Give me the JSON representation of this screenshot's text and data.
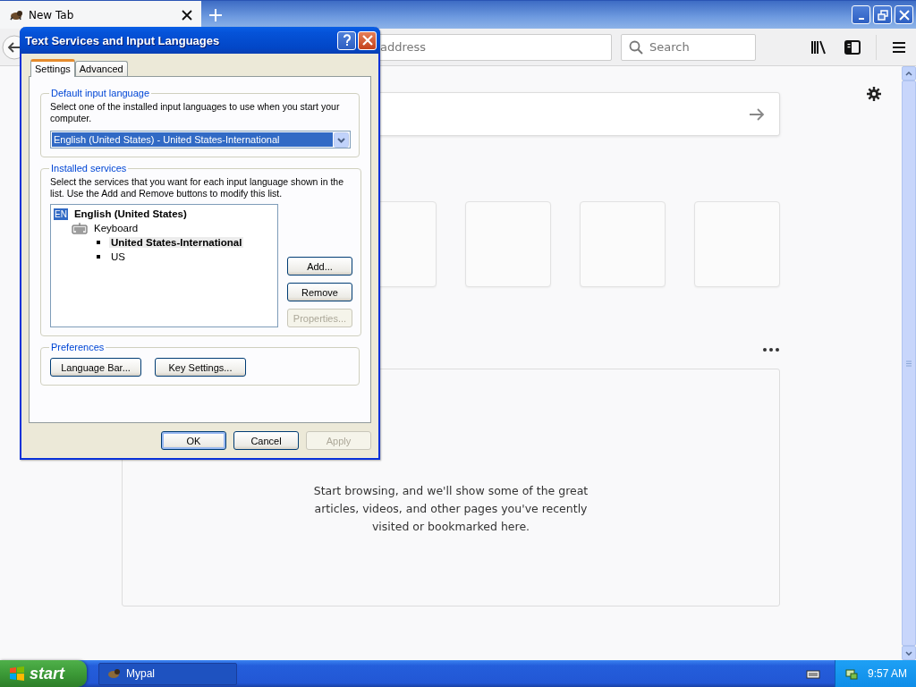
{
  "browser": {
    "tabs": [
      {
        "label": "New Tab",
        "selected": true
      }
    ],
    "address_bar": {
      "placeholder": "address"
    },
    "search_bar": {
      "placeholder": "Search"
    },
    "new_tab_page": {
      "highlights_message": "Start browsing, and we'll show some of the great articles, videos, and other pages you've recently visited or bookmarked here."
    }
  },
  "dialog": {
    "title": "Text Services and Input Languages",
    "tabs": [
      {
        "label": "Settings",
        "selected": true
      },
      {
        "label": "Advanced",
        "selected": false
      }
    ],
    "default_input_language": {
      "legend": "Default input language",
      "description": "Select one of the installed input languages to use when you start your computer.",
      "value": "English (United States) - United States-International"
    },
    "installed_services": {
      "legend": "Installed services",
      "description": "Select the services that you want for each input language shown in the list. Use the Add and Remove buttons to modify this list.",
      "tree": [
        {
          "kind": "language",
          "badge": "EN",
          "label": "English (United States)",
          "selected": false,
          "children": [
            {
              "kind": "category",
              "label": "Keyboard",
              "selected": false,
              "children": [
                {
                  "kind": "layout",
                  "label": "United States-International",
                  "selected": true
                },
                {
                  "kind": "layout",
                  "label": "US",
                  "selected": false
                }
              ]
            }
          ]
        }
      ],
      "buttons": [
        {
          "label": "Add...",
          "disabled": false
        },
        {
          "label": "Remove",
          "disabled": false
        },
        {
          "label": "Properties...",
          "disabled": true
        }
      ]
    },
    "preferences": {
      "legend": "Preferences",
      "buttons": [
        {
          "label": "Language Bar...",
          "disabled": false
        },
        {
          "label": "Key Settings...",
          "disabled": false
        }
      ]
    },
    "buttons": [
      {
        "label": "OK",
        "default": true,
        "disabled": false
      },
      {
        "label": "Cancel",
        "default": false,
        "disabled": false
      },
      {
        "label": "Apply",
        "default": false,
        "disabled": true
      }
    ]
  },
  "taskbar": {
    "start": "start",
    "tasks": [
      {
        "label": "Mypal",
        "selected": false
      }
    ],
    "clock": "9:57 AM"
  }
}
